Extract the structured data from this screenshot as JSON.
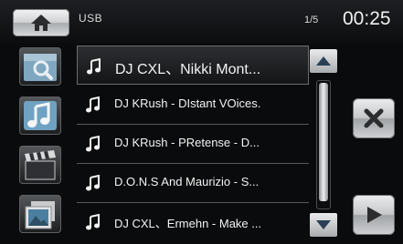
{
  "header": {
    "source_label": "USB",
    "page_indicator": "1/5",
    "clock": "00:25",
    "home_icon": "home-icon"
  },
  "sidebar": {
    "items": [
      {
        "icon": "folder-search-icon"
      },
      {
        "icon": "music-note-icon"
      },
      {
        "icon": "clapperboard-icon"
      },
      {
        "icon": "photo-icon"
      }
    ]
  },
  "playlist": {
    "selected_index": 0,
    "tracks": [
      {
        "title": "DJ CXL、Nikki Mont..."
      },
      {
        "title": "DJ KRush - DIstant VOices."
      },
      {
        "title": "DJ KRush - PRetense - D..."
      },
      {
        "title": "D.O.N.S And Maurizio - S..."
      },
      {
        "title": "DJ CXL、Ermehn - Make ..."
      }
    ]
  },
  "scrollbar": {
    "position": 0.0
  },
  "actions": {
    "close_icon": "close-icon",
    "play_icon": "play-icon"
  },
  "colors": {
    "background": "#0a0b0c",
    "text": "#f2f2f2",
    "button_silver": "#c6c8ca"
  }
}
